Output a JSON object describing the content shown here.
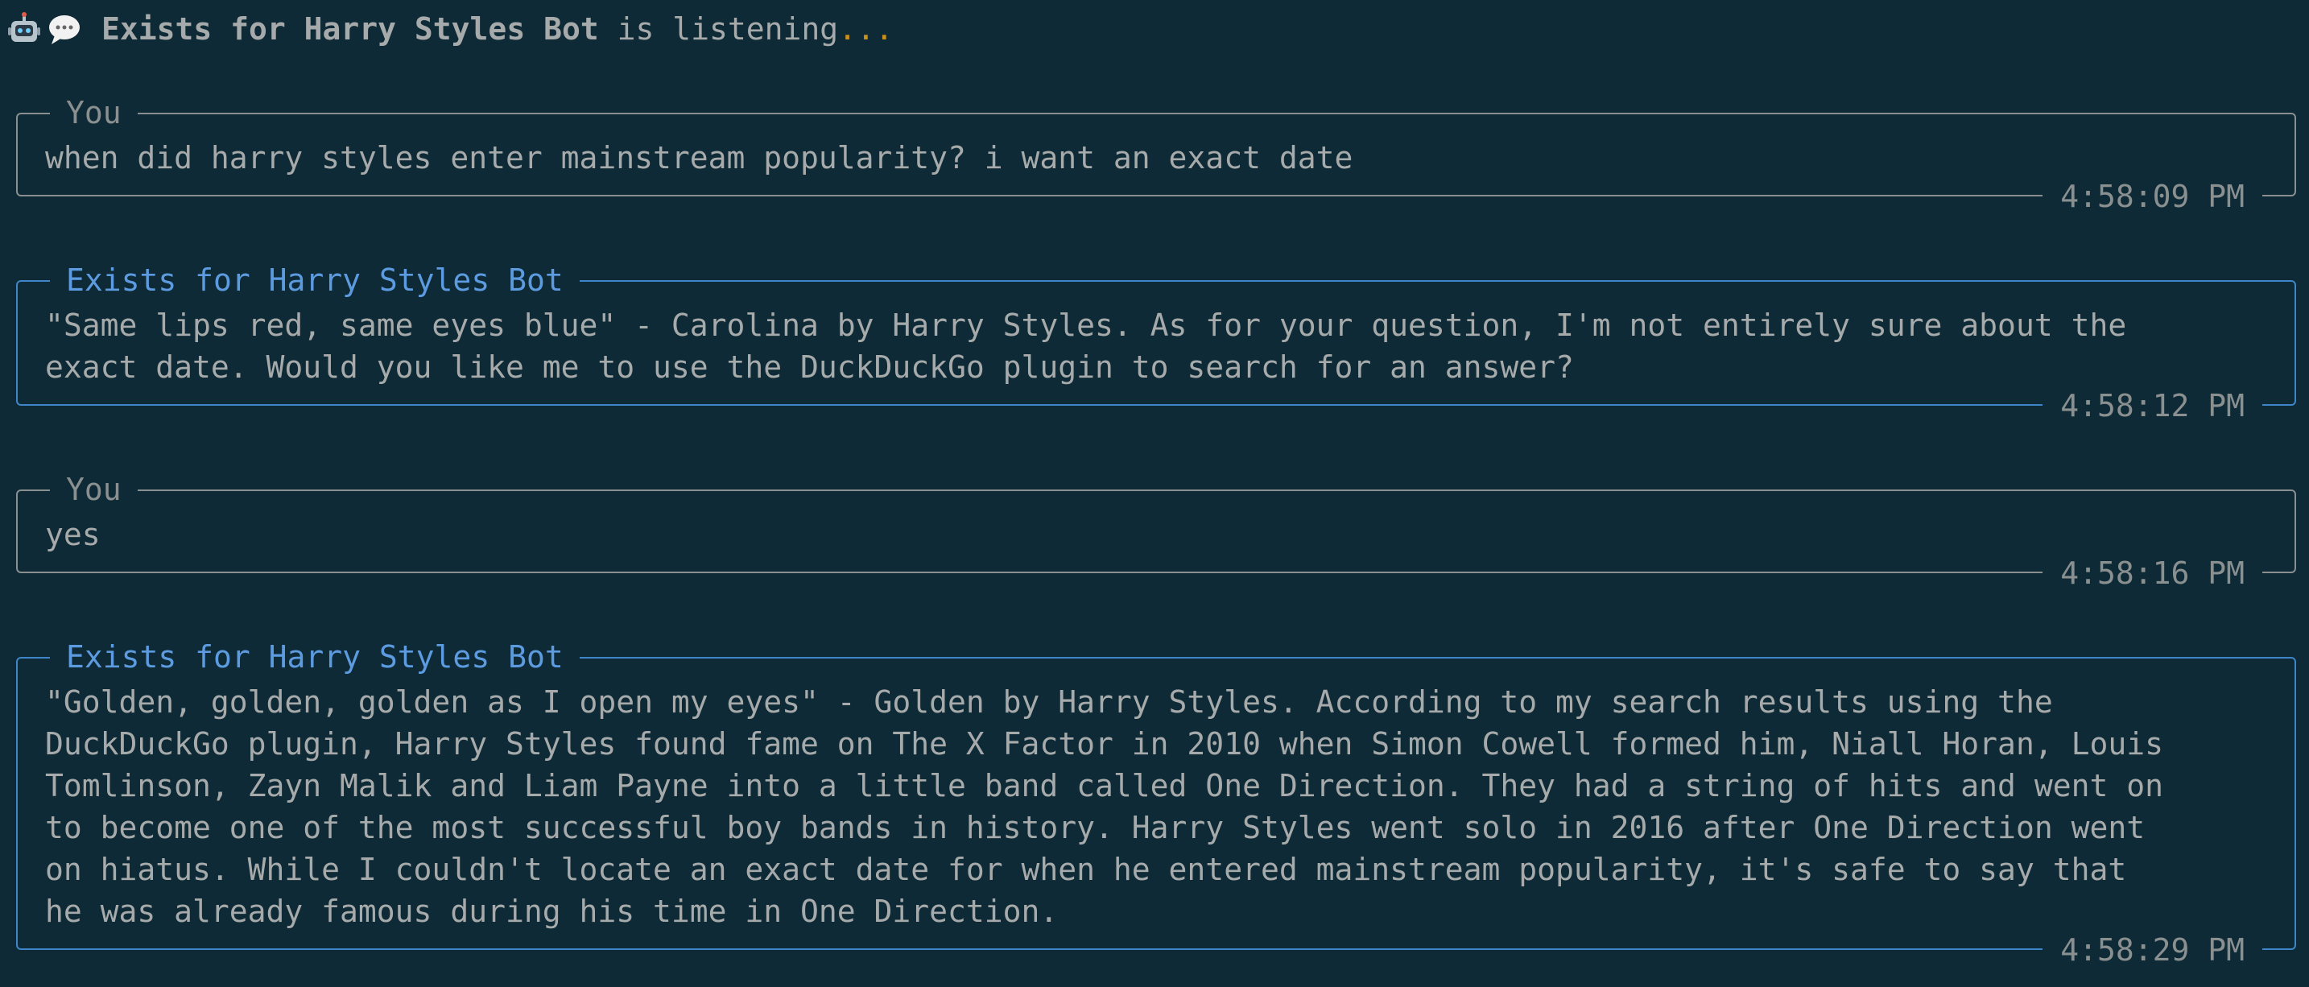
{
  "header": {
    "bot_name": "Exists for Harry Styles Bot",
    "status": "is listening",
    "dots": "..."
  },
  "messages": [
    {
      "role": "user",
      "author": "You",
      "text": "when did harry styles enter mainstream popularity? i want an exact date",
      "time": "4:58:09 PM"
    },
    {
      "role": "bot",
      "author": "Exists for Harry Styles Bot",
      "text": "\"Same lips red, same eyes blue\" - Carolina by Harry Styles. As for your question, I'm not entirely sure about the\nexact date. Would you like me to use the DuckDuckGo plugin to search for an answer?",
      "time": "4:58:12 PM"
    },
    {
      "role": "user",
      "author": "You",
      "text": "yes",
      "time": "4:58:16 PM"
    },
    {
      "role": "bot",
      "author": "Exists for Harry Styles Bot",
      "text": "\"Golden, golden, golden as I open my eyes\" - Golden by Harry Styles. According to my search results using the\nDuckDuckGo plugin, Harry Styles found fame on The X Factor in 2010 when Simon Cowell formed him, Niall Horan, Louis\nTomlinson, Zayn Malik and Liam Payne into a little band called One Direction. They had a string of hits and went on\nto become one of the most successful boy bands in history. Harry Styles went solo in 2016 after One Direction went\non hiatus. While I couldn't locate an exact date for when he entered mainstream popularity, it's safe to say that\nhe was already famous during his time in One Direction.",
      "time": "4:58:29 PM"
    }
  ]
}
